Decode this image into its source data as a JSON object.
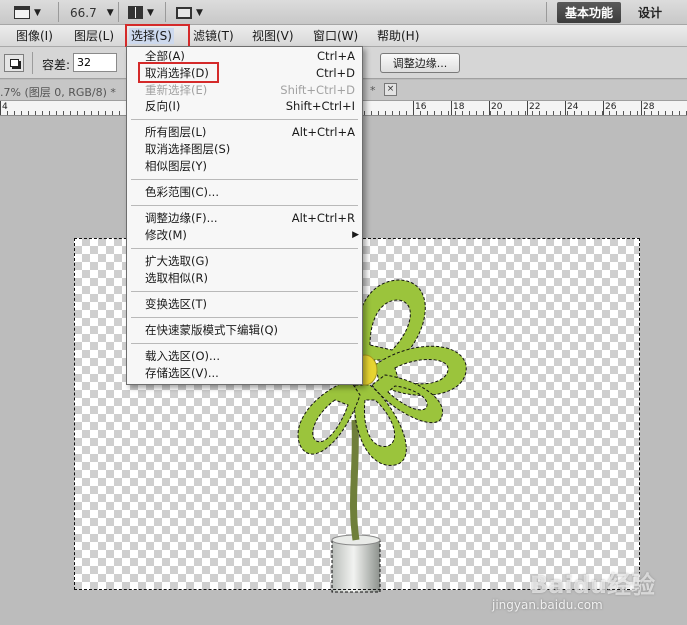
{
  "appbar": {
    "zoom": "66.7",
    "workspace_basic": "基本功能",
    "workspace_design": "设计"
  },
  "menubar": {
    "items": [
      "图像(I)",
      "图层(L)",
      "选择(S)",
      "滤镜(T)",
      "视图(V)",
      "窗口(W)",
      "帮助(H)"
    ]
  },
  "options": {
    "tolerance_label": "容差:",
    "tolerance_value": "32",
    "refine_edge": "调整边缘..."
  },
  "document": {
    "tab_title": ".7% (图层 0, RGB/8) *",
    "tab_star": "*",
    "close": "×"
  },
  "ruler": {
    "labels": [
      "4",
      "16",
      "18",
      "20",
      "22",
      "24",
      "26",
      "28"
    ]
  },
  "select_menu": {
    "items": [
      {
        "label": "全部(A)",
        "shortcut": "Ctrl+A"
      },
      {
        "label": "取消选择(D)",
        "shortcut": "Ctrl+D"
      },
      {
        "label": "重新选择(E)",
        "shortcut": "Shift+Ctrl+D"
      },
      {
        "label": "反向(I)",
        "shortcut": "Shift+Ctrl+I"
      },
      {
        "label": "所有图层(L)",
        "shortcut": "Alt+Ctrl+A"
      },
      {
        "label": "取消选择图层(S)",
        "shortcut": ""
      },
      {
        "label": "相似图层(Y)",
        "shortcut": ""
      },
      {
        "label": "色彩范围(C)...",
        "shortcut": ""
      },
      {
        "label": "调整边缘(F)...",
        "shortcut": "Alt+Ctrl+R"
      },
      {
        "label": "修改(M)",
        "shortcut": ""
      },
      {
        "label": "扩大选取(G)",
        "shortcut": ""
      },
      {
        "label": "选取相似(R)",
        "shortcut": ""
      },
      {
        "label": "变换选区(T)",
        "shortcut": ""
      },
      {
        "label": "在快速蒙版模式下编辑(Q)",
        "shortcut": ""
      },
      {
        "label": "载入选区(O)...",
        "shortcut": ""
      },
      {
        "label": "存储选区(V)...",
        "shortcut": ""
      }
    ]
  },
  "watermark": {
    "logo": "Baidu经验",
    "url": "jingyan.baidu.com"
  },
  "colors": {
    "highlight_box": "#d42a2a",
    "leaf_green": "#9bc43c",
    "flower_center": "#e7d431",
    "stem": "#6f7f3a"
  }
}
